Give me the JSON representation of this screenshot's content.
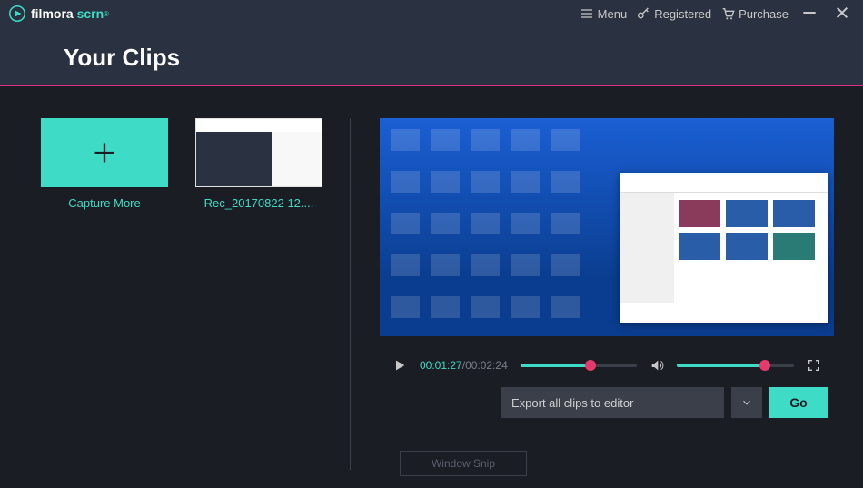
{
  "logo": {
    "brand": "filmora",
    "product": "scrn",
    "tm": "®"
  },
  "titlebar": {
    "menu": "Menu",
    "registered": "Registered",
    "purchase": "Purchase"
  },
  "page_title": "Your Clips",
  "clips": {
    "capture_label": "Capture More",
    "items": [
      {
        "label": "Rec_20170822 12...."
      }
    ]
  },
  "player": {
    "current_time": "00:01:27",
    "duration": "00:02:24"
  },
  "export": {
    "selected": "Export all clips to editor",
    "go": "Go"
  },
  "window_snip": "Window Snip"
}
